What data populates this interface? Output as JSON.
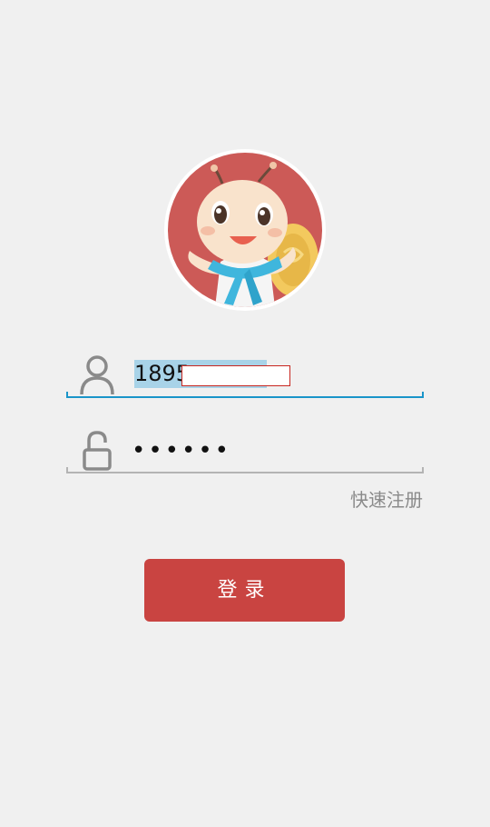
{
  "avatar": {
    "icon": "bee-mascot-avatar",
    "background_color": "#cc5a57"
  },
  "login_form": {
    "phone": {
      "icon": "user-icon",
      "value": "1895"
    },
    "password": {
      "icon": "unlock-icon",
      "value": "••••••"
    },
    "register_link": "快速注册",
    "login_button": "登录"
  },
  "colors": {
    "page_background": "#f0f0f0",
    "active_underline": "#1a95c9",
    "inactive_underline": "#b4b4b4",
    "primary_button": "#c94441",
    "selection_highlight": "#a8d3e8"
  }
}
